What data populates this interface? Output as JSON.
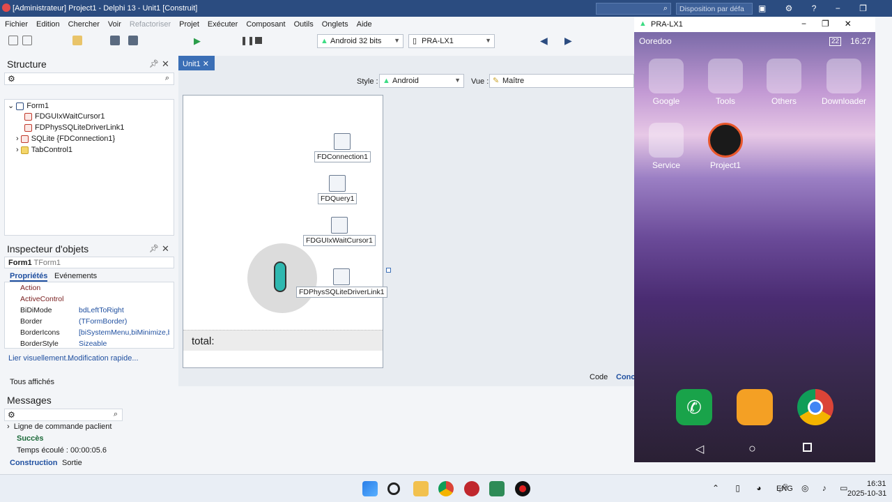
{
  "window": {
    "title": "[Administrateur] Project1 - Delphi 13 - Unit1 [Construit]",
    "search_placeholder": "",
    "layout_combo": "Disposition par défa"
  },
  "menu": [
    "Fichier",
    "Edition",
    "Chercher",
    "Voir",
    "Refactoriser",
    "Projet",
    "Exécuter",
    "Composant",
    "Outils",
    "Onglets",
    "Aide"
  ],
  "toolbar": {
    "platform": "Android 32 bits",
    "device": "PRA-LX1"
  },
  "structure": {
    "title": "Structure",
    "items": [
      "Form1",
      "FDGUIxWaitCursor1",
      "FDPhysSQLiteDriverLink1",
      "SQLite {FDConnection1}",
      "TabControl1"
    ]
  },
  "inspector": {
    "title": "Inspecteur d'objets",
    "object": "Form1",
    "object_type": "TForm1",
    "tab_props": "Propriétés",
    "tab_events": "Evénements",
    "rows": [
      {
        "n": "Action",
        "v": ""
      },
      {
        "n": "ActiveControl",
        "v": ""
      },
      {
        "n": "BiDiMode",
        "v": "bdLeftToRight"
      },
      {
        "n": "Border",
        "v": "(TFormBorder)"
      },
      {
        "n": "BorderIcons",
        "v": "[biSystemMenu,biMinimize,bi"
      },
      {
        "n": "BorderStyle",
        "v": "Sizeable"
      }
    ],
    "link1": "Lier visuellement...",
    "link2": "Modification rapide...",
    "footer": "Tous affichés"
  },
  "editor": {
    "tab": "Unit1",
    "style_label": "Style :",
    "style_value": "Android",
    "view_label": "Vue :",
    "view_value": "Maître",
    "code_tab": "Code",
    "design_tab": "Conce"
  },
  "form": {
    "components": [
      "FDConnection1",
      "FDQuery1",
      "FDGUIxWaitCursor1",
      "FDPhysSQLiteDriverLink1"
    ],
    "total_label": "total:"
  },
  "messages": {
    "title": "Messages",
    "lines": [
      "Ligne de commande paclient",
      "Succès",
      "Temps écoulé :  00:00:05.6"
    ],
    "tab_build": "Construction",
    "tab_output": "Sortie"
  },
  "phone": {
    "title": "PRA-LX1",
    "carrier": "Ooredoo",
    "time": "16:27",
    "battery": "22",
    "apps": [
      "Google",
      "Tools",
      "Others",
      "Downloader",
      "Service",
      "Project1"
    ]
  },
  "system": {
    "lang": "ENG",
    "time": "16:31",
    "date": "2025-10-31"
  },
  "colors": {
    "accent": "#2b4c80",
    "link": "#2050a0"
  }
}
